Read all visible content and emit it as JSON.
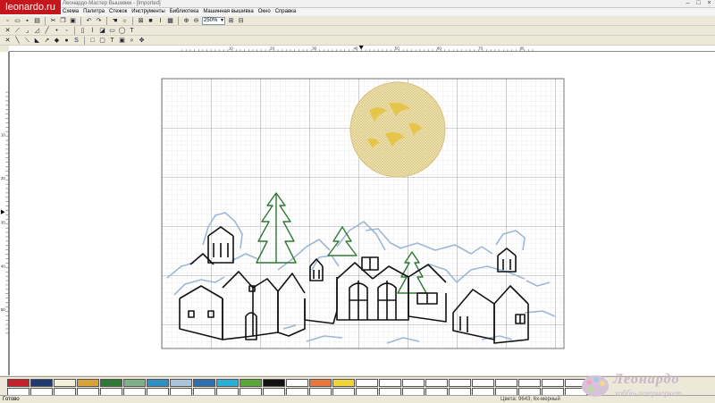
{
  "watermark": "leonardo.ru",
  "window": {
    "title": "Леонардо-Мастер Вышивки - [Imported]"
  },
  "menu": [
    "Схема",
    "Палитра",
    "Стежок",
    "Инструменты",
    "Библиотека",
    "Машинная вышивка",
    "Окно",
    "Справка"
  ],
  "toolbar": {
    "zoom_value": "250%"
  },
  "ruler": {
    "top_labels": [
      "10",
      "20",
      "30",
      "40",
      "50",
      "60",
      "70",
      "80"
    ],
    "left_labels": [
      "10",
      "20",
      "30",
      "40",
      "50"
    ]
  },
  "palette": {
    "row1": [
      "#c8202a",
      "#1f3a6e",
      "#f5f0d8",
      "#d9a23a",
      "#2e7a34",
      "#7fb08a",
      "#2f8fc4",
      "#a9c3dd",
      "#2e6fb0",
      "#2ab0d8",
      "#5aa63a",
      "#111111",
      "#ffffff",
      "#e7773a",
      "#f0d23a",
      "#ffffff",
      "#ffffff",
      "#ffffff",
      "#ffffff",
      "#ffffff",
      "#ffffff",
      "#ffffff",
      "#ffffff",
      "#ffffff",
      "#ffffff"
    ],
    "row2": [
      "#ffffff",
      "#ffffff",
      "#ffffff",
      "#ffffff",
      "#ffffff",
      "#ffffff",
      "#ffffff",
      "#ffffff",
      "#ffffff",
      "#ffffff",
      "#ffffff",
      "#ffffff",
      "#ffffff",
      "#ffffff",
      "#ffffff",
      "#ffffff",
      "#ffffff",
      "#ffffff",
      "#ffffff",
      "#ffffff",
      "#ffffff",
      "#ffffff",
      "#ffffff",
      "#ffffff",
      "#ffffff"
    ]
  },
  "status": {
    "left": "Готово",
    "right": "Цвета: 9643, 6x-мерный"
  },
  "logo": {
    "title": "Леонардо",
    "subtitle": "хобби-гипермаркет"
  },
  "colors": {
    "moon": "#e8d27a",
    "tree": "#2e7a34",
    "snow": "#9fb7d6",
    "house": "#111111",
    "grid": "#c8c8c8"
  }
}
